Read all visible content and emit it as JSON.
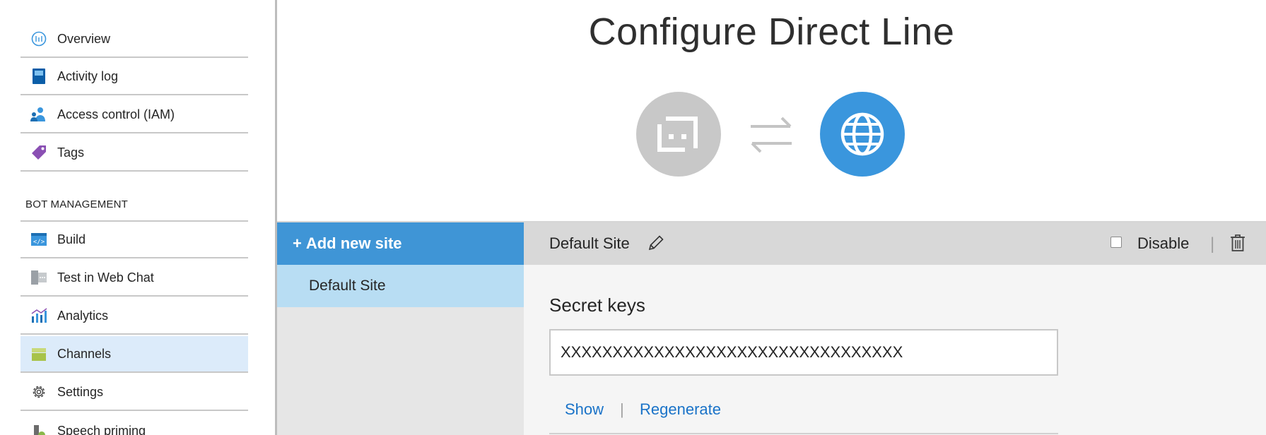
{
  "sidebar": {
    "items": [
      {
        "label": "Overview",
        "icon": "overview-icon"
      },
      {
        "label": "Activity log",
        "icon": "activity-log-icon"
      },
      {
        "label": "Access control (IAM)",
        "icon": "access-control-icon"
      },
      {
        "label": "Tags",
        "icon": "tag-icon"
      }
    ],
    "section_header": "BOT MANAGEMENT",
    "bot_items": [
      {
        "label": "Build",
        "icon": "code-icon"
      },
      {
        "label": "Test in Web Chat",
        "icon": "web-chat-icon"
      },
      {
        "label": "Analytics",
        "icon": "analytics-icon"
      },
      {
        "label": "Channels",
        "icon": "channels-icon",
        "active": true
      },
      {
        "label": "Settings",
        "icon": "gear-icon"
      },
      {
        "label": "Speech priming",
        "icon": "speech-priming-icon"
      }
    ]
  },
  "main": {
    "title": "Configure Direct Line"
  },
  "sites": {
    "add_label": "Add new site",
    "add_prefix": "+",
    "list": [
      "Default Site"
    ]
  },
  "detail": {
    "site_name": "Default Site",
    "disable_label": "Disable",
    "separator": "|",
    "secret_title": "Secret keys",
    "secret_value": "XXXXXXXXXXXXXXXXXXXXXXXXXXXXXXXXX",
    "show_label": "Show",
    "regenerate_label": "Regenerate"
  },
  "colors": {
    "accent": "#3f95d6",
    "selected_site": "#b8ddf3",
    "active_nav": "#dcebfa",
    "link": "#1a73c8"
  }
}
